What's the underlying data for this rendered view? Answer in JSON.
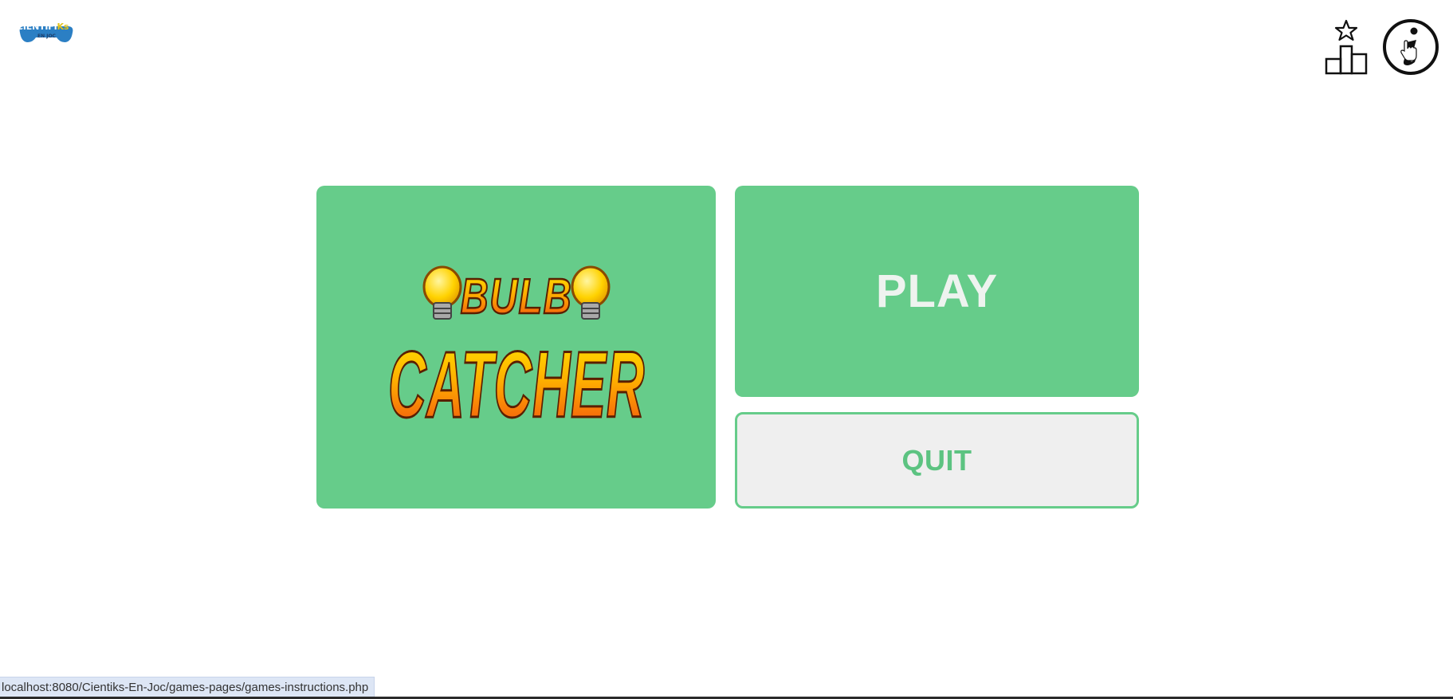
{
  "logo": {
    "brand_part1": "CIENTIFI",
    "brand_highlight": "Ks",
    "brand_sub": "EN JOC"
  },
  "header": {
    "icons": [
      "leaderboard-icon",
      "info-icon"
    ]
  },
  "game": {
    "title_line1": "BULB",
    "title_line2": "CATCHER"
  },
  "buttons": {
    "play_label": "PLAY",
    "quit_label": "QUIT"
  },
  "status": {
    "url": "localhost:8080/Cientiks-En-Joc/games-pages/games-instructions.php"
  },
  "colors": {
    "accent_green": "#66cc8a",
    "quit_bg": "#efefef",
    "title_yellow": "#ffd200",
    "title_orange": "#f05a14"
  }
}
